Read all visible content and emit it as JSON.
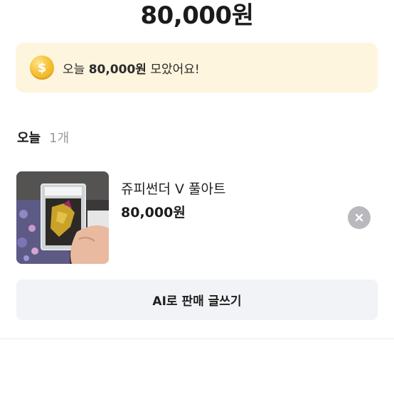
{
  "header": {
    "total_amount": "80,000원"
  },
  "banner": {
    "icon": "coin-icon",
    "prefix": "오늘",
    "amount": "80,000원",
    "suffix": "모았어요!"
  },
  "section": {
    "title": "오늘",
    "count": "1개"
  },
  "items": [
    {
      "name": "쥬피썬더 V 풀아트",
      "price": "80,000원",
      "image": "graded-card-photo"
    }
  ],
  "actions": {
    "ai_write_label": "AI로 판매 글쓰기"
  },
  "colors": {
    "banner_bg": "#fdf5de",
    "coin": "#f7c338",
    "button_bg": "#f2f3f6",
    "remove_bg": "#b9b9bd",
    "muted_text": "#9b9b9b"
  }
}
